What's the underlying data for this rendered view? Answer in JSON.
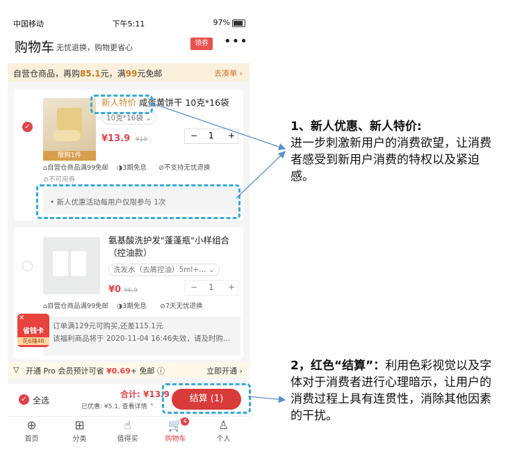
{
  "status_bar": {
    "carrier": "中国移动",
    "time": "下午5:11",
    "battery": "97%"
  },
  "header": {
    "title": "购物车",
    "subtitle": "无忧退换，购物更省心",
    "coupon_label": "领券",
    "more_label": "•••"
  },
  "banner": {
    "prefix": "自营仓商品，再购",
    "amount": "85.1",
    "mid": "元，满",
    "threshold": "99",
    "suffix": "元免邮",
    "action": "去凑单 ›"
  },
  "item1": {
    "tag": "新人特价",
    "name": "咸蛋黄饼干 10克*16袋",
    "spec": "10克*16袋 ⌄",
    "limit": "限购1件",
    "price": "¥13.9",
    "original_price": "¥19",
    "qty": "1",
    "minus": "−",
    "plus": "+",
    "services": [
      "自营仓商品满99免邮",
      "3期免息",
      "不支持无忧退换"
    ],
    "coupon_note": "不可用券",
    "promo_note": "• 新人优惠活动每用户仅限参与 1次"
  },
  "item2": {
    "name": "氨基酸洗护发\"蓬蓬瓶\"小样组合（控油款）",
    "spec": "洗发水（去屑控油）5ml+… ⌄",
    "price": "¥0",
    "original_price": "¥6.9",
    "qty": "1",
    "minus": "−",
    "plus": "+",
    "services": [
      "自营仓商品满99免邮",
      "3期免息",
      "7天无忧退换"
    ],
    "note1": "订单满129元可购买,还差115.1元",
    "note2": "该福利商品将于 2020-11-04 16:46失效，请及时购..."
  },
  "float_badge": {
    "label": "省钱卡",
    "sub": "花6赚48"
  },
  "pro_bar": {
    "text_prefix": "开通 Pro 会员预计可省 ",
    "amount": "¥0.69",
    "text_suffix": "+ 免邮 ⓘ",
    "action": "立即开通 ›"
  },
  "checkout_bar": {
    "select_all": "全选",
    "total_label": "合计:",
    "total": "¥13.9",
    "discount": "已优惠: ¥5.1, 查看详情 ⌃",
    "checkout": "结算 (1)"
  },
  "tabbar": [
    {
      "label": "首页",
      "icon": "⊕"
    },
    {
      "label": "分类",
      "icon": "⊞"
    },
    {
      "label": "值得买",
      "icon": "☝"
    },
    {
      "label": "购物车",
      "icon": "🛒",
      "badge": "4"
    },
    {
      "label": "个人",
      "icon": "♙"
    }
  ],
  "annotations": {
    "a1_title": "1、新人优惠、新人特价:",
    "a1_body": "进一步刺激新用户的消费欲望，让消费者感受到新用户消费的特权以及紧迫感。",
    "a2_title": "2，红色“结算”：",
    "a2_body": "利用色彩视觉以及字体对于消费者进行心理暗示，让用户的消费过程上具有连贯性，消除其他因素的干扰。"
  },
  "colors": {
    "accent": "#e0434a",
    "annotation": "#38a9d6",
    "banner_bg": "#fbf0dc"
  }
}
